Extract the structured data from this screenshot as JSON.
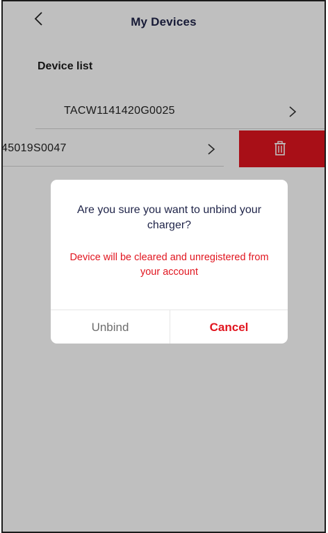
{
  "header": {
    "title": "My Devices",
    "back_icon": "chevron-left-icon"
  },
  "device_list": {
    "title": "Device list",
    "items": [
      {
        "serial": "TACW1141420G0025",
        "icon": "chevron-right-icon"
      },
      {
        "serial": "45019S0047",
        "icon": "chevron-right-icon"
      }
    ],
    "delete_action": {
      "icon": "trash-icon",
      "color": "#e1151f"
    }
  },
  "dialog": {
    "question": "Are you sure you want to unbind your charger?",
    "warning": "Device will be cleared and unregistered from your account",
    "unbind_label": "Unbind",
    "cancel_label": "Cancel"
  },
  "colors": {
    "accent": "#e1151f",
    "title": "#20254a"
  }
}
